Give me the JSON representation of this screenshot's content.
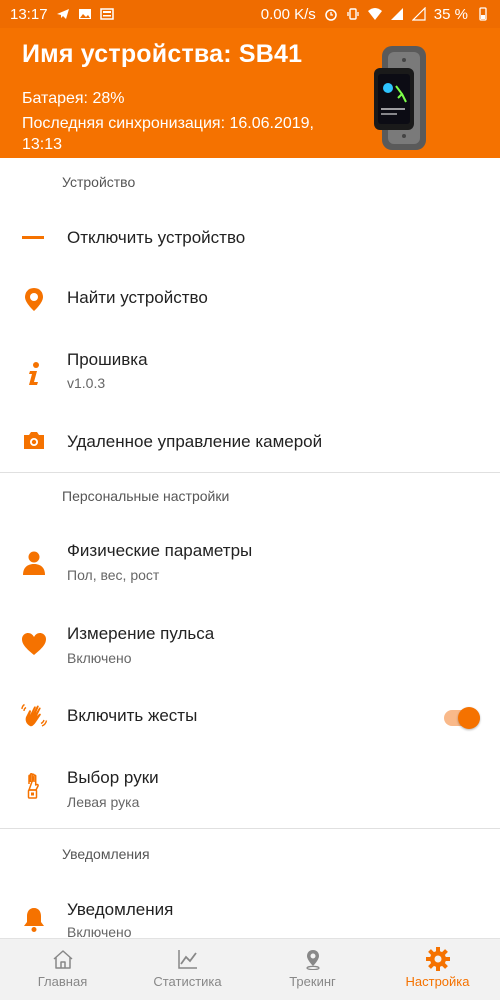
{
  "status_bar": {
    "time": "13:17",
    "net_speed": "0.00 K/s",
    "battery": "35 %"
  },
  "header": {
    "title": "Имя устройства: SB41",
    "battery": "Батарея:  28%",
    "last_sync": "Последняя синхронизация: 16.06.2019, 13:13"
  },
  "sections": {
    "device": "Устройство",
    "personal": "Персональные настройки",
    "notifications": "Уведомления"
  },
  "items": {
    "disconnect": {
      "label": "Отключить устройство"
    },
    "find": {
      "label": "Найти устройство"
    },
    "firmware": {
      "label": "Прошивка",
      "sub": "v1.0.3"
    },
    "camera": {
      "label": "Удаленное управление камерой"
    },
    "physical": {
      "label": "Физические параметры",
      "sub": "Пол, вес, рост"
    },
    "pulse": {
      "label": "Измерение пульса",
      "sub": "Включено"
    },
    "gestures": {
      "label": "Включить жесты",
      "enabled": true
    },
    "hand": {
      "label": "Выбор руки",
      "sub": "Левая рука"
    },
    "notifications": {
      "label": "Уведомления",
      "sub": "Включено"
    }
  },
  "bottom_nav": {
    "home": "Главная",
    "stats": "Статистика",
    "tracking": "Трекинг",
    "settings": "Настройка"
  },
  "colors": {
    "accent": "#f57200",
    "status_bar": "#ef6c00"
  },
  "icons": {
    "disconnect": "minus-icon",
    "find": "location-pin-icon",
    "firmware": "info-icon",
    "camera": "camera-icon",
    "physical": "person-icon",
    "pulse": "heart-icon",
    "gestures": "wave-hand-icon",
    "hand": "watch-hand-icon",
    "notifications": "bell-icon"
  }
}
